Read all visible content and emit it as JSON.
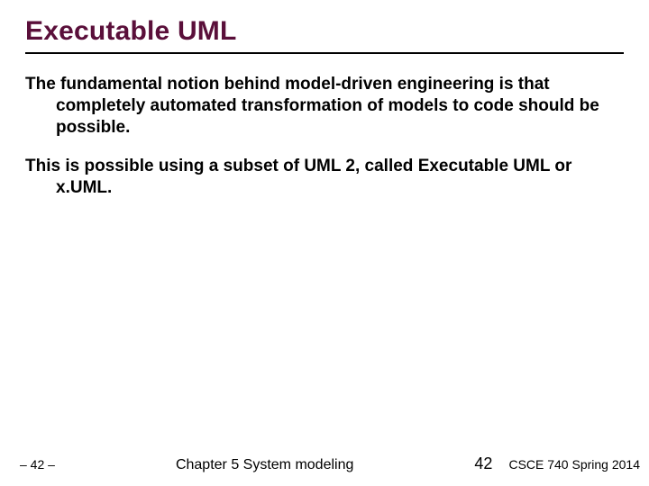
{
  "title": "Executable UML",
  "paragraphs": [
    "The fundamental notion behind model-driven engineering is that completely automated transformation of models to code should be possible.",
    "This is possible using a subset of UML 2, called Executable UML or x.UML."
  ],
  "footer": {
    "slide_num_left": "– 42 –",
    "center": "Chapter 5 System modeling",
    "page": "42",
    "course": "CSCE 740 Spring  2014"
  }
}
